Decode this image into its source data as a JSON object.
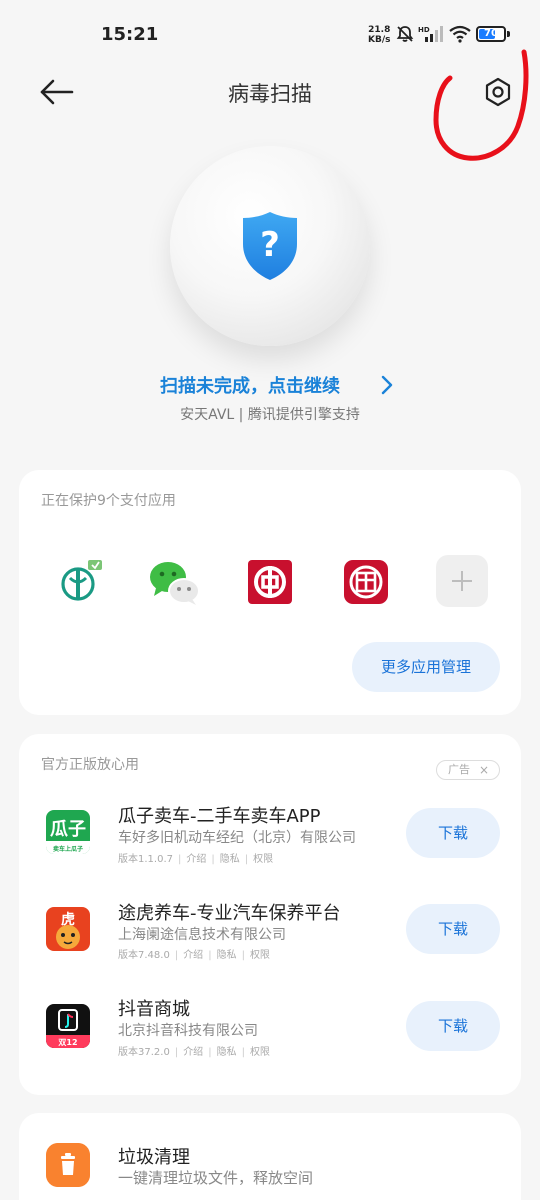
{
  "status_bar": {
    "time": "15:21",
    "net_speed_value": "21.8",
    "net_speed_unit": "KB/s",
    "battery_level": "70",
    "icons": [
      "bell-muted-icon",
      "hd-signal-icon",
      "wifi-icon",
      "battery-icon"
    ]
  },
  "header": {
    "title": "病毒扫描",
    "back_icon": "arrow-left-icon",
    "settings_icon": "settings-hexagon-icon"
  },
  "scan": {
    "status_icon": "shield-question-icon",
    "status_text": "扫描未完成，点击继续",
    "engine_text": "安天AVL | 腾讯提供引擎支持"
  },
  "payment_protection": {
    "title": "正在保护9个支付应用",
    "apps": [
      {
        "name": "农业银行",
        "icon": "abc-bank-icon"
      },
      {
        "name": "微信",
        "icon": "wechat-icon"
      },
      {
        "name": "中国银行",
        "icon": "boc-bank-icon"
      },
      {
        "name": "工商银行",
        "icon": "icbc-bank-icon"
      }
    ],
    "add_icon": "plus-icon",
    "manage_button": "更多应用管理"
  },
  "recommended": {
    "title": "官方正版放心用",
    "ad_label": "广告",
    "ad_close": "×",
    "apps": [
      {
        "name": "瓜子卖车-二手车卖车APP",
        "company": "车好多旧机动车经纪（北京）有限公司",
        "version": "版本1.1.0.7",
        "intro": "介绍",
        "privacy": "隐私",
        "permissions": "权限",
        "button": "下载",
        "icon_text": "瓜子",
        "icon_sub": "卖车上瓜子"
      },
      {
        "name": "途虎养车-专业汽车保养平台",
        "company": "上海阑途信息技术有限公司",
        "version": "版本7.48.0",
        "intro": "介绍",
        "privacy": "隐私",
        "permissions": "权限",
        "button": "下载",
        "icon_text": "虎"
      },
      {
        "name": "抖音商城",
        "company": "北京抖音科技有限公司",
        "version": "版本37.2.0",
        "intro": "介绍",
        "privacy": "隐私",
        "permissions": "权限",
        "button": "下载",
        "icon_sub": "双12"
      }
    ]
  },
  "cleanup": {
    "title": "垃圾清理",
    "subtitle": "一键清理垃圾文件，释放空间",
    "icon": "trash-icon"
  },
  "colors": {
    "accent_blue": "#1a82d8",
    "button_bg": "#e8f1fc",
    "annotation_red": "#e8101a",
    "cleanup_orange": "#f9822f"
  }
}
